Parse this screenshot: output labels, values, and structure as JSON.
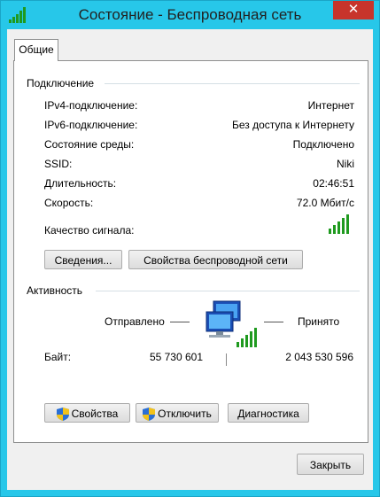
{
  "window": {
    "title": "Состояние - Беспроводная сеть",
    "close_label": "✕"
  },
  "tabs": [
    {
      "label": "Общие"
    }
  ],
  "connection": {
    "heading": "Подключение",
    "rows": [
      {
        "label": "IPv4-подключение:",
        "value": "Интернет"
      },
      {
        "label": "IPv6-подключение:",
        "value": "Без доступа к Интернету"
      },
      {
        "label": "Состояние среды:",
        "value": "Подключено"
      },
      {
        "label": "SSID:",
        "value": "Niki"
      },
      {
        "label": "Длительность:",
        "value": "02:46:51"
      },
      {
        "label": "Скорость:",
        "value": "72.0 Мбит/с"
      }
    ],
    "signal_label": "Качество сигнала:",
    "signal_bars": 5,
    "details_button": "Сведения...",
    "wireless_props_button": "Свойства беспроводной сети"
  },
  "activity": {
    "heading": "Активность",
    "sent_label": "Отправлено",
    "received_label": "Принято",
    "bytes_label": "Байт:",
    "bytes_sent": "55 730 601",
    "bytes_received": "2 043 530 596"
  },
  "actions": {
    "properties_button": "Свойства",
    "disable_button": "Отключить",
    "diagnose_button": "Диагностика"
  },
  "footer": {
    "close_button": "Закрыть"
  },
  "colors": {
    "frame": "#27c7e9",
    "close": "#c7342b",
    "signal": "#1f9a1f"
  }
}
